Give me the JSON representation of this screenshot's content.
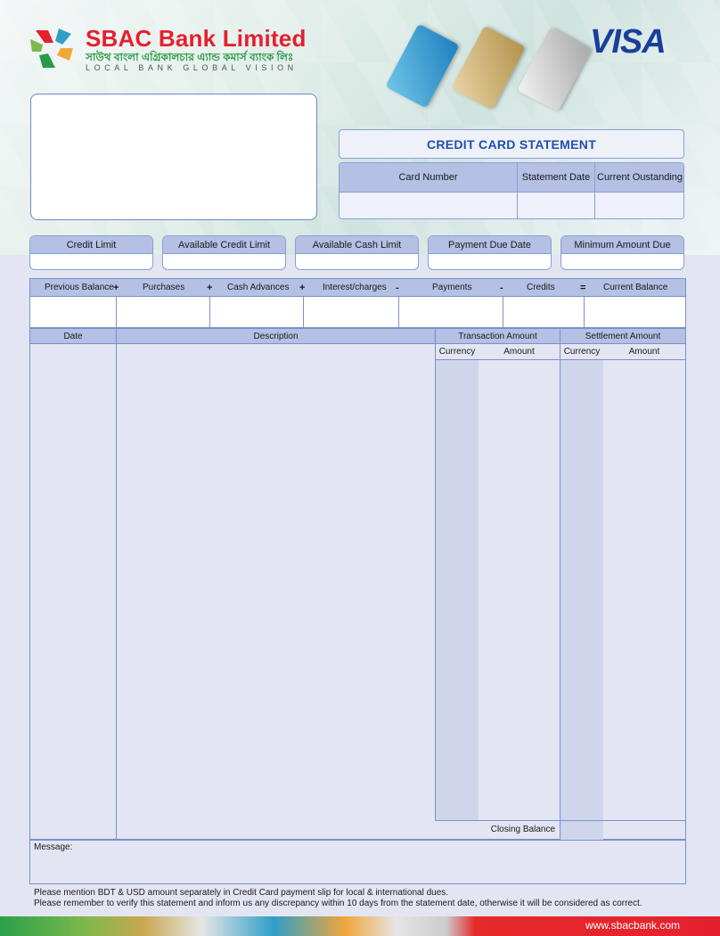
{
  "header": {
    "bank_name": "SBAC Bank Limited",
    "bank_name_bangla": "সাউথ বাংলা এগ্রিকালচার এ্যান্ড কমার্স ব্যাংক লিঃ",
    "tagline": "LOCAL BANK GLOBAL VISION",
    "card_brand": "VISA",
    "brand_colors": {
      "red": "#e5202e",
      "green": "#2a9a46",
      "visa_blue": "#1a3f9a"
    }
  },
  "statement": {
    "title": "CREDIT CARD STATEMENT",
    "columns": [
      "Card Number",
      "Statement Date",
      "Current Oustanding"
    ]
  },
  "summary": {
    "boxes": [
      "Credit Limit",
      "Available Credit Limit",
      "Available Cash Limit",
      "Payment Due Date",
      "Minimum Amount Due"
    ]
  },
  "balance": {
    "labels": [
      "Previous Balance",
      "Purchases",
      "Cash Advances",
      "Interest/charges",
      "Payments",
      "Credits",
      "Current Balance"
    ],
    "operators": [
      "+",
      "+",
      "+",
      "-",
      "-",
      "="
    ]
  },
  "transactions": {
    "date_header": "Date",
    "description_header": "Description",
    "transaction_amount_header": "Transaction Amount",
    "settlement_amount_header": "Settlement Amount",
    "currency_label": "Currency",
    "amount_label": "Amount",
    "closing_balance_label": "Closing Balance"
  },
  "message": {
    "label": "Message:"
  },
  "footnotes": [
    "Please mention BDT & USD amount separately in Credit Card payment slip for local & international dues.",
    "Please remember to verify this statement and inform us any discrepancy within 10 days from the statement date, otherwise it will be considered as correct."
  ],
  "footer": {
    "url": "www.sbacbank.com"
  }
}
